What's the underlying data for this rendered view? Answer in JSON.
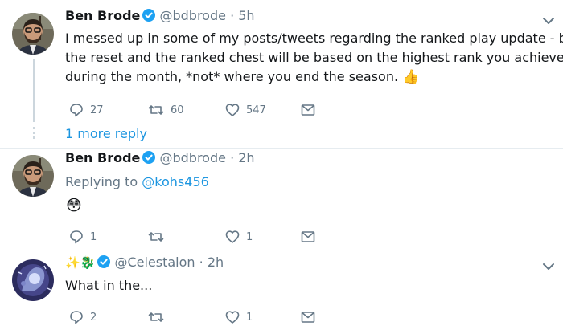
{
  "tweets": [
    {
      "name": "Ben Brode",
      "handle": "@bdbrode",
      "time": "· 5h",
      "text_lines": [
        "I messed up in some of my posts/tweets regarding the ranked play update - both",
        "the reset and the ranked chest will be based on the highest rank you achieved",
        "during the month, *not* where you end the season. "
      ],
      "emoji": "👍",
      "replies": "27",
      "retweets": "60",
      "likes": "547"
    },
    {
      "more_replies": "1 more reply"
    },
    {
      "name": "Ben Brode",
      "handle": "@bdbrode",
      "time": "· 2h",
      "replying_prefix": "Replying to ",
      "replying_to": "@kohs456",
      "emoji": "😳",
      "replies": "1",
      "retweets": "",
      "likes": "1"
    },
    {
      "name_emoji": "✨🐉",
      "handle": "@Celestalon",
      "time": "· 2h",
      "text": "What in the...",
      "replies": "2",
      "retweets": "",
      "likes": "1"
    }
  ],
  "colors": {
    "link": "#1b95e0",
    "secondary": "#657786",
    "verified": "#1da1f2",
    "thread_line": "#ccd6dd"
  },
  "icons": [
    "reply-icon",
    "retweet-icon",
    "like-icon",
    "dm-icon",
    "caret-down-icon",
    "verified-badge-icon"
  ]
}
